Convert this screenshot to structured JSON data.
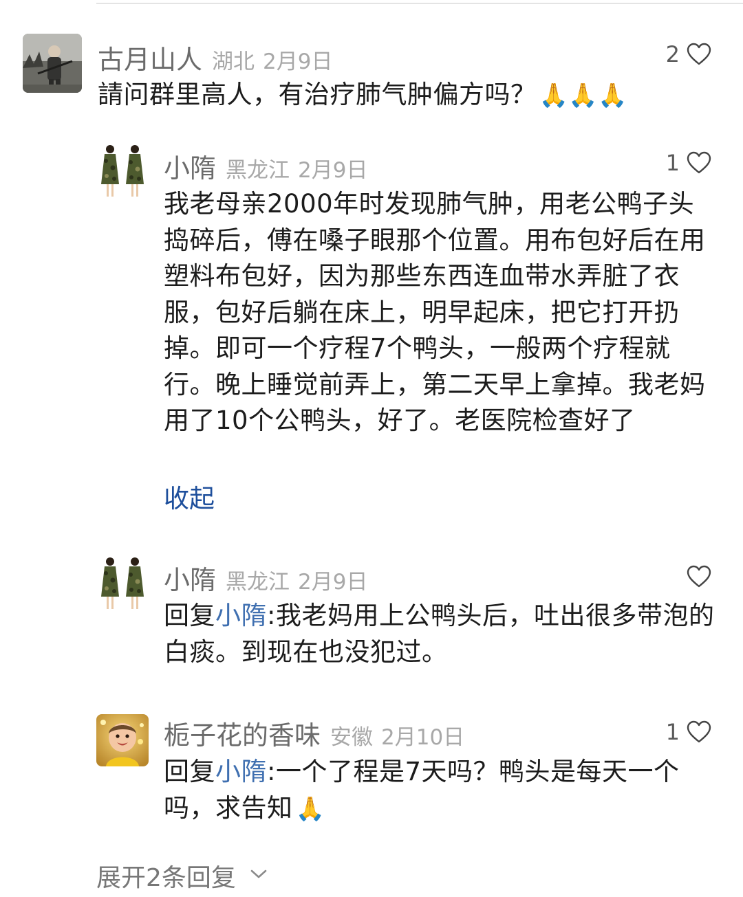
{
  "comments": [
    {
      "name": "古月山人",
      "region": "湖北",
      "date": "2月9日",
      "likes": "2",
      "text": "請问群里高人，有治疗肺气肿偏方吗？",
      "emoji": "🙏🙏🙏",
      "avatar_icon": "person-with-rifle-photo-icon"
    },
    {
      "name": "小隋",
      "region": "黑龙江",
      "date": "2月9日",
      "likes": "1",
      "text": "我老母亲2000年时发现肺气肿，用老公鸭子头捣碎后，傅在嗓子眼那个位置。用布包好后在用塑料布包好，因为那些东西连血带水弄脏了衣服，包好后躺在床上，明早起床，把它打开扔掉。即可一个疗程7个鸭头，一般两个疗程就行。晚上睡觉前弄上，第二天早上拿掉。我老妈用了10个公鸭头，好了。老医院检查好了",
      "collapse_label": "收起",
      "avatar_icon": "two-women-in-camo-dresses-icon"
    },
    {
      "name": "小隋",
      "region": "黑龙江",
      "date": "2月9日",
      "likes": "",
      "reply_prefix": "回复",
      "reply_to": "小隋",
      "text": ":我老妈用上公鸭头后，吐出很多带泡的白痰。到现在也没犯过。",
      "avatar_icon": "two-women-in-camo-dresses-icon"
    },
    {
      "name": "栀子花的香味",
      "region": "安徽",
      "date": "2月10日",
      "likes": "1",
      "reply_prefix": "回复",
      "reply_to": "小隋",
      "text": ":一个了程是7天吗？鸭头是每天一个吗，求告知",
      "emoji": "🙏",
      "avatar_icon": "smiling-baby-icon"
    }
  ],
  "expand_replies": {
    "label": "展开2条回复",
    "icon": "chevron-down-icon"
  },
  "colors": {
    "name": "#6b6b6b",
    "meta": "#a8a8a8",
    "reply_link": "#3f6fb0",
    "collapse_link": "#1e4f9c"
  }
}
